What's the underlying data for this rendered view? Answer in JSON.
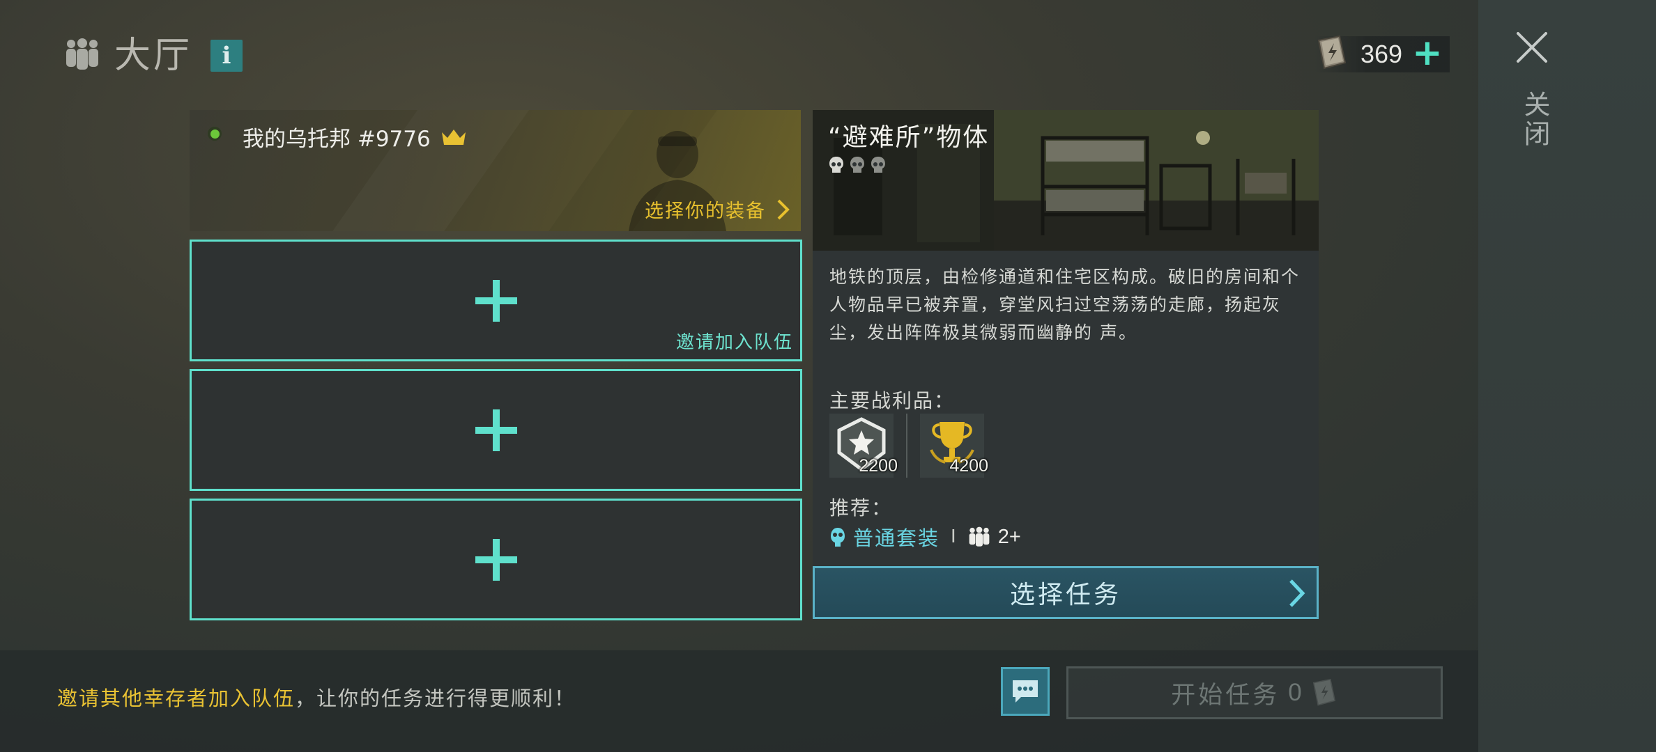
{
  "header": {
    "title": "大厅",
    "info_icon": "i"
  },
  "currency": {
    "icon": "energy-book-icon",
    "value": "369"
  },
  "close": {
    "label": "关闭"
  },
  "team": {
    "player": {
      "name": "我的乌托邦 #9776",
      "status": "online",
      "gear_link": "选择你的装备"
    },
    "slots": [
      {
        "invite_label": "邀请加入队伍"
      },
      {
        "invite_label": ""
      },
      {
        "invite_label": ""
      }
    ]
  },
  "mission": {
    "title": "“避难所”物体",
    "difficulty_skulls": 3,
    "description": "地铁的顶层，由检修通道和住宅区构成。破旧的房间和个人物品早已被弃置，穿堂风扫过空荡荡的走廊，扬起灰尘，发出阵阵极其微弱而幽静的 声。",
    "loot_label": "主要战利品：",
    "loot": [
      {
        "icon": "star-badge-icon",
        "amount": "2200"
      },
      {
        "icon": "trophy-icon",
        "amount": "4200"
      }
    ],
    "recommend_label": "推荐：",
    "recommend_kit": "普通套装",
    "recommend_separator": "I",
    "recommend_players": "2+",
    "select_button": "选择任务"
  },
  "bottom": {
    "hint_highlight": "邀请其他幸存者加入队伍",
    "hint_rest": "，让你的任务进行得更顺利！",
    "start_label": "开始任务",
    "start_cost": "0"
  },
  "colors": {
    "accent": "#5fe0cc",
    "highlight": "#e9c233",
    "select_button": "#2a5463"
  }
}
